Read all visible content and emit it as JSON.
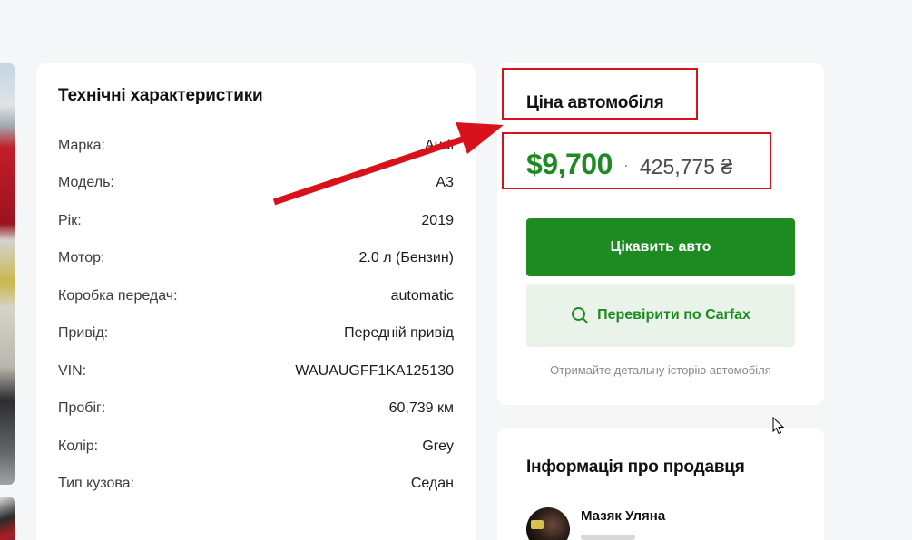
{
  "specs": {
    "title": "Технічні характеристики",
    "rows": [
      {
        "label": "Марка:",
        "value": "Audi"
      },
      {
        "label": "Модель:",
        "value": "A3"
      },
      {
        "label": "Рік:",
        "value": "2019"
      },
      {
        "label": "Мотор:",
        "value": "2.0 л (Бензин)"
      },
      {
        "label": "Коробка передач:",
        "value": "automatic"
      },
      {
        "label": "Привід:",
        "value": "Передній привід"
      },
      {
        "label": "VIN:",
        "value": "WAUAUGFF1KA125130"
      },
      {
        "label": "Пробіг:",
        "value": "60,739 км"
      },
      {
        "label": "Колір:",
        "value": "Grey"
      },
      {
        "label": "Тип кузова:",
        "value": "Седан"
      }
    ]
  },
  "price": {
    "title": "Ціна автомобіля",
    "usd": "$9,700",
    "separator": "·",
    "uah": "425,775 ₴",
    "primary_button": "Цікавить авто",
    "secondary_button": "Перевірити по Carfax",
    "hint": "Отримайте детальну історію автомобіля"
  },
  "seller": {
    "title": "Інформація про продавця",
    "name": "Мазяк Уляна"
  },
  "colors": {
    "brand_green": "#1e8a22",
    "annotation_red": "#d9111b",
    "secondary_bg": "#e9f3ea"
  },
  "icons": {
    "carfax_button_icon": "search-icon",
    "cursor": "mouse-pointer-icon"
  }
}
